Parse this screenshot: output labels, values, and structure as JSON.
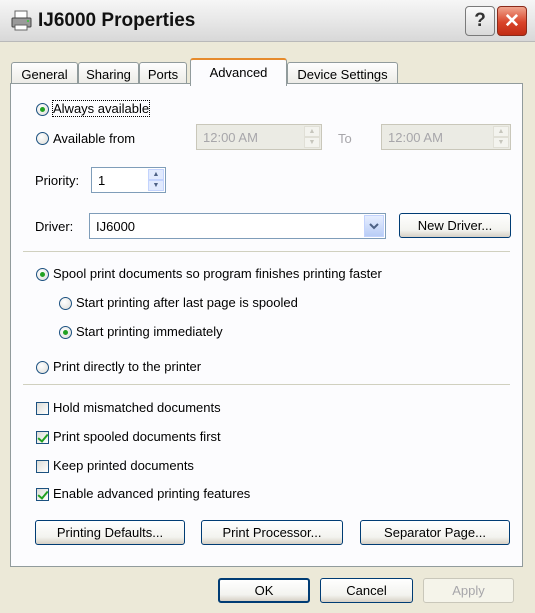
{
  "window": {
    "title": "IJ6000 Properties",
    "help_label": "?",
    "close_label": "✕",
    "icon": "printer-icon"
  },
  "tabs": [
    {
      "label": "General"
    },
    {
      "label": "Sharing"
    },
    {
      "label": "Ports"
    },
    {
      "label": "Advanced",
      "active": true
    },
    {
      "label": "Device Settings"
    }
  ],
  "availability": {
    "always_label": "Always available",
    "from_label": "Available from",
    "from_time": "12:00 AM",
    "to_label": "To",
    "to_time": "12:00 AM",
    "selected": "always"
  },
  "priority": {
    "label": "Priority:",
    "value": "1"
  },
  "driver": {
    "label": "Driver:",
    "value": "IJ6000",
    "new_driver_label": "New Driver..."
  },
  "spool": {
    "spool_label": "Spool print documents so program finishes printing faster",
    "after_last_page_label": "Start printing after last page is spooled",
    "immediately_label": "Start printing immediately",
    "direct_label": "Print directly to the printer",
    "mode": "spool",
    "start": "immediately"
  },
  "options": [
    {
      "label": "Hold mismatched documents",
      "checked": false
    },
    {
      "label": "Print spooled documents first",
      "checked": true
    },
    {
      "label": "Keep printed documents",
      "checked": false
    },
    {
      "label": "Enable advanced printing features",
      "checked": true
    }
  ],
  "buttons": {
    "printing_defaults": "Printing Defaults...",
    "print_processor": "Print Processor...",
    "separator_page": "Separator Page...",
    "ok": "OK",
    "cancel": "Cancel",
    "apply": "Apply"
  },
  "colors": {
    "radio_dot": "#21a121",
    "active_tab_accent": "#e68b2c",
    "close_button": "#d9442a"
  }
}
